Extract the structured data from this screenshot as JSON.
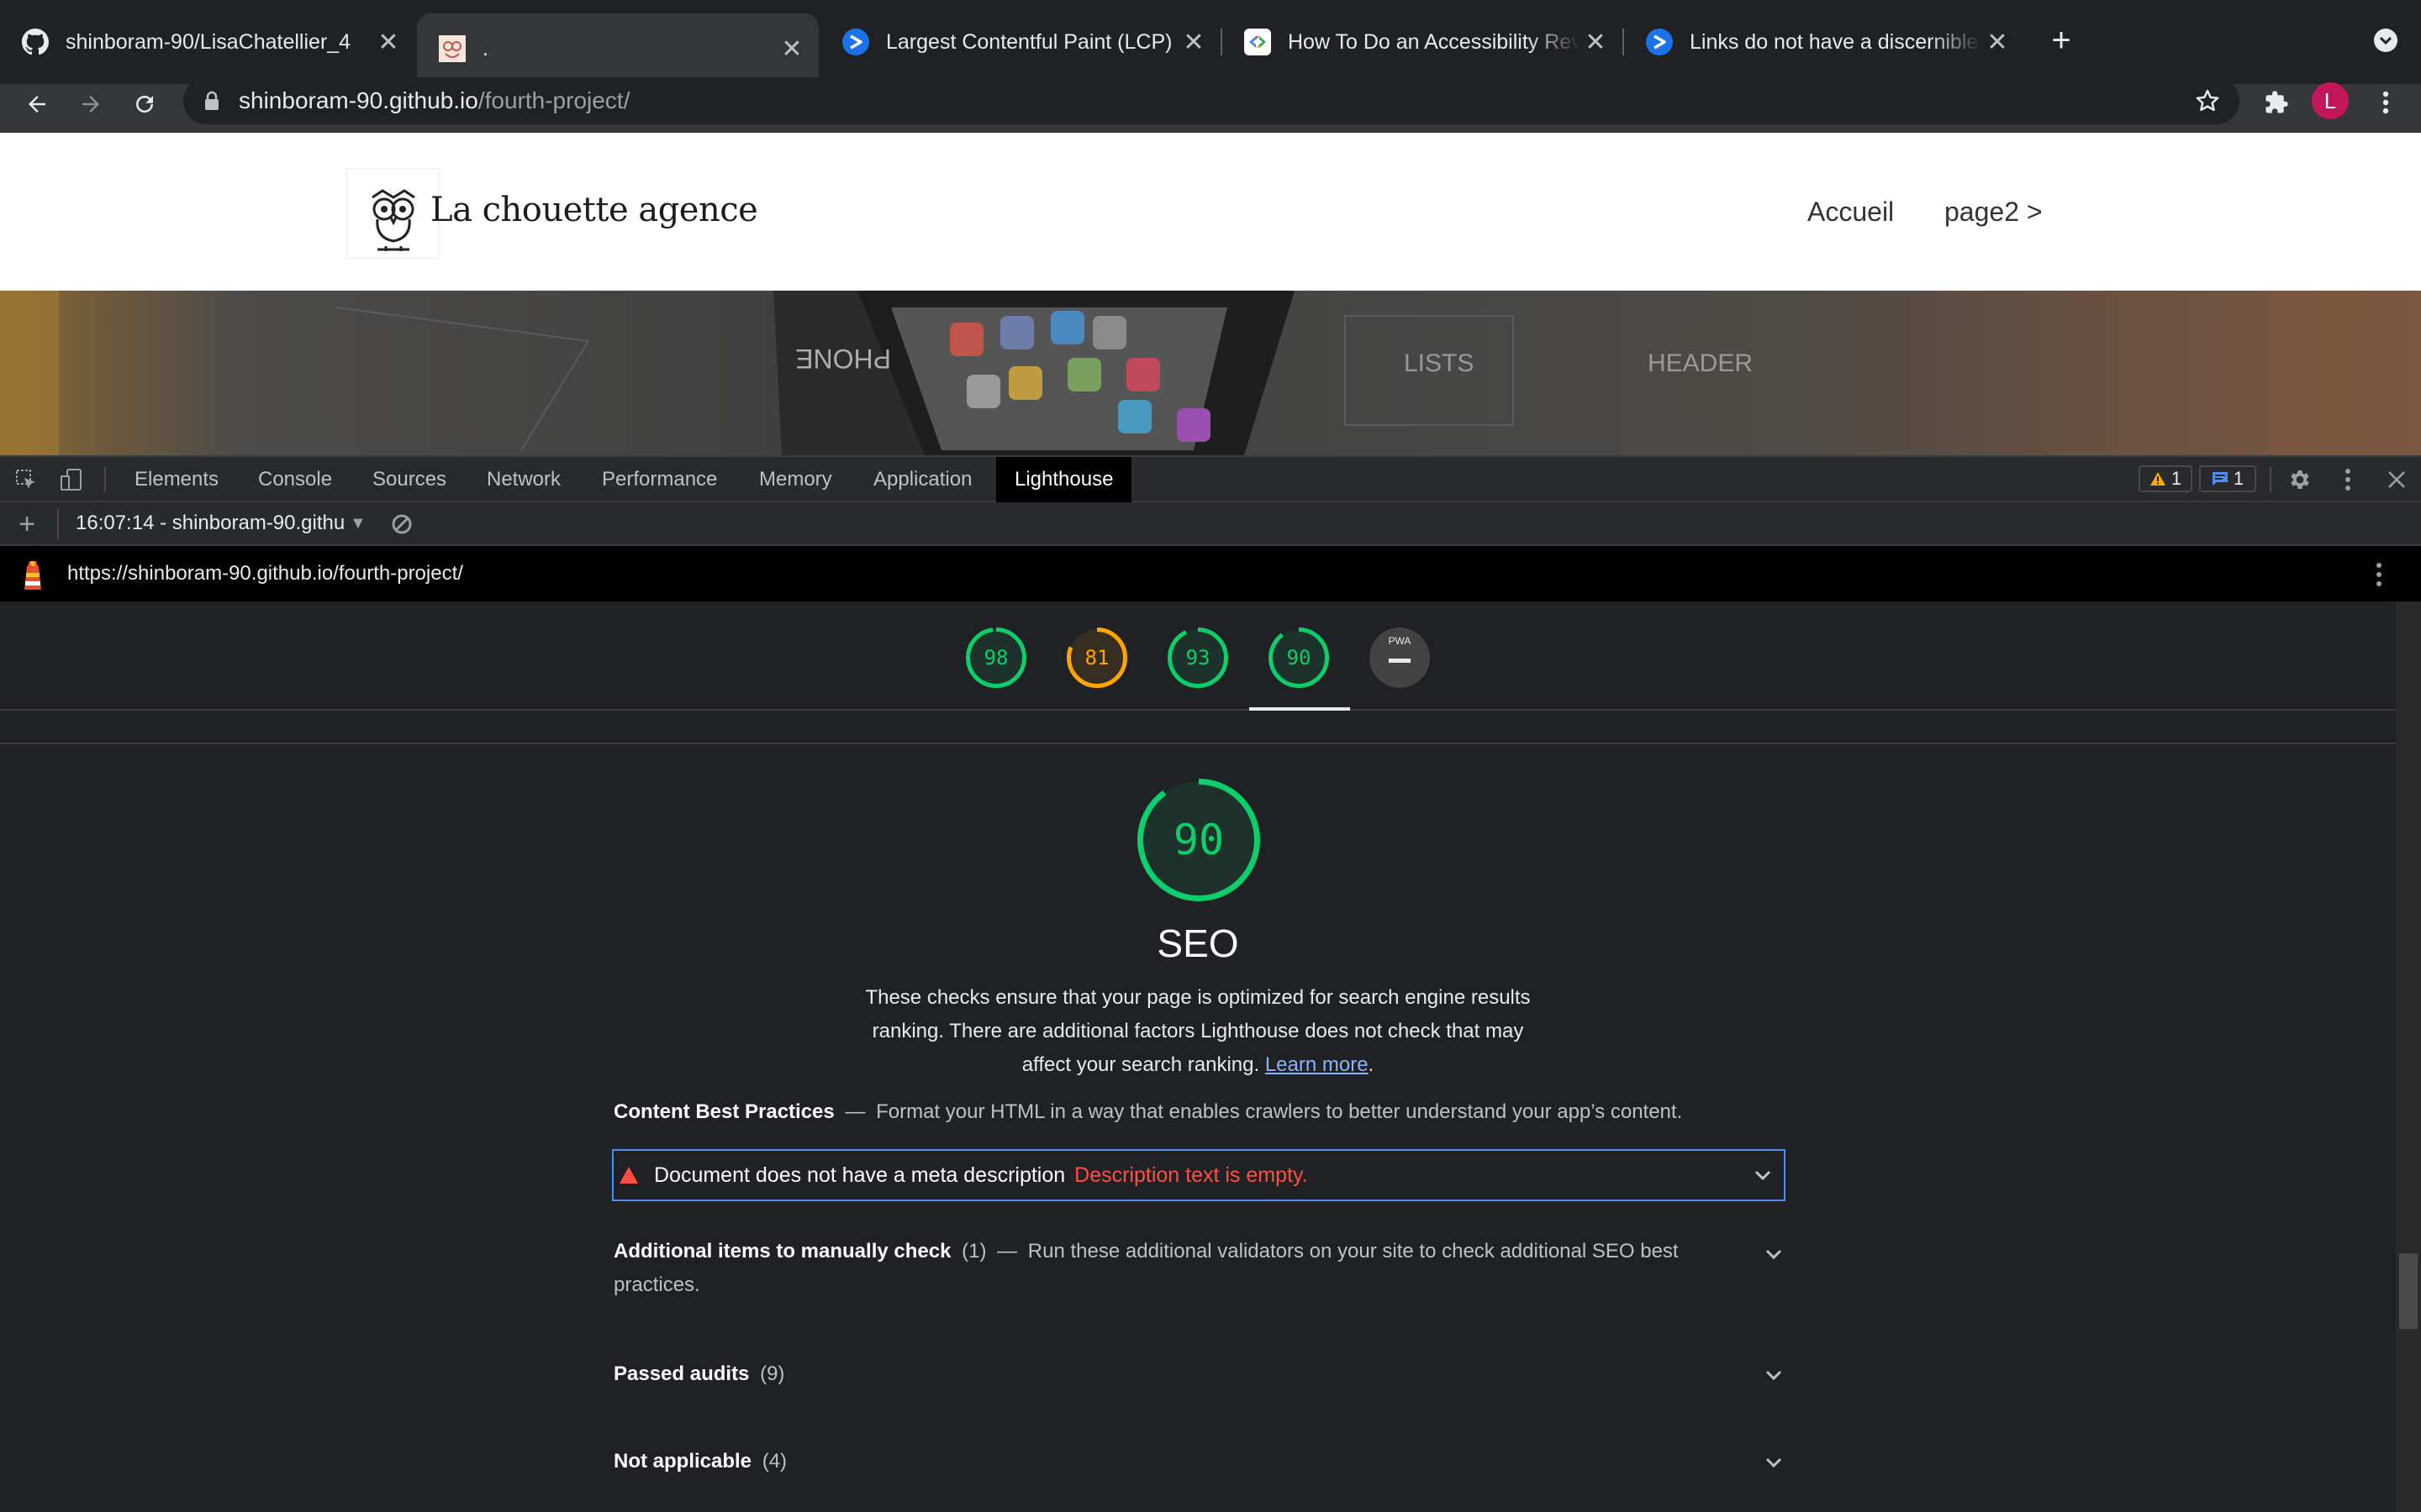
{
  "browser": {
    "tabs": [
      {
        "title": "shinboram-90/LisaChatellier_4",
        "icon": "github-icon",
        "active": false
      },
      {
        "title": ".",
        "icon": "owl-favicon",
        "active": true
      },
      {
        "title": "Largest Contentful Paint (LCP)",
        "icon": "webdev-icon",
        "active": false
      },
      {
        "title": "How To Do an Accessibility Rev",
        "icon": "google-dev-icon",
        "active": false
      },
      {
        "title": "Links do not have a discernible",
        "icon": "webdev-icon",
        "active": false
      }
    ],
    "url_host": "shinboram-90.github.io",
    "url_path": "/fourth-project/",
    "profile_initial": "L",
    "colors": {
      "profile": "#c2185b"
    }
  },
  "site": {
    "brand": "La chouette agence",
    "nav": [
      "Accueil",
      "page2 >"
    ]
  },
  "devtools": {
    "tabs": [
      "Elements",
      "Console",
      "Sources",
      "Network",
      "Performance",
      "Memory",
      "Application",
      "Lighthouse"
    ],
    "active_tab": "Lighthouse",
    "warning_count": "1",
    "message_count": "1",
    "report_selector": "16:07:14 - shinboram-90.githu",
    "report_url": "https://shinboram-90.github.io/fourth-project/"
  },
  "lighthouse": {
    "scores": [
      {
        "value": 98,
        "label": "98",
        "color": "#0cce6b"
      },
      {
        "value": 81,
        "label": "81",
        "color": "#ffa400"
      },
      {
        "value": 93,
        "label": "93",
        "color": "#0cce6b"
      },
      {
        "value": 90,
        "label": "90",
        "color": "#0cce6b"
      }
    ],
    "pwa_label": "PWA",
    "category": {
      "score": 90,
      "score_label": "90",
      "title": "SEO",
      "description_line1": "These checks ensure that your page is optimized for search engine results",
      "description_line2": "ranking. There are additional factors Lighthouse does not check that may",
      "description_line3": "affect your search ranking.",
      "learn_more": "Learn more",
      "period": "."
    },
    "content_group": {
      "title": "Content Best Practices",
      "dash": "—",
      "description": "Format your HTML in a way that enables crawlers to better understand your app’s content."
    },
    "failed_audit": {
      "title": "Document does not have a meta description",
      "display_value": "Description text is empty."
    },
    "manual_group": {
      "title": "Additional items to manually check",
      "count": "(1)",
      "dash": "—",
      "description_line1": "Run these additional validators on your site to check additional SEO best",
      "description_line2": "practices."
    },
    "passed_group": {
      "title": "Passed audits",
      "count": "(9)"
    },
    "na_group": {
      "title": "Not applicable",
      "count": "(4)"
    }
  }
}
